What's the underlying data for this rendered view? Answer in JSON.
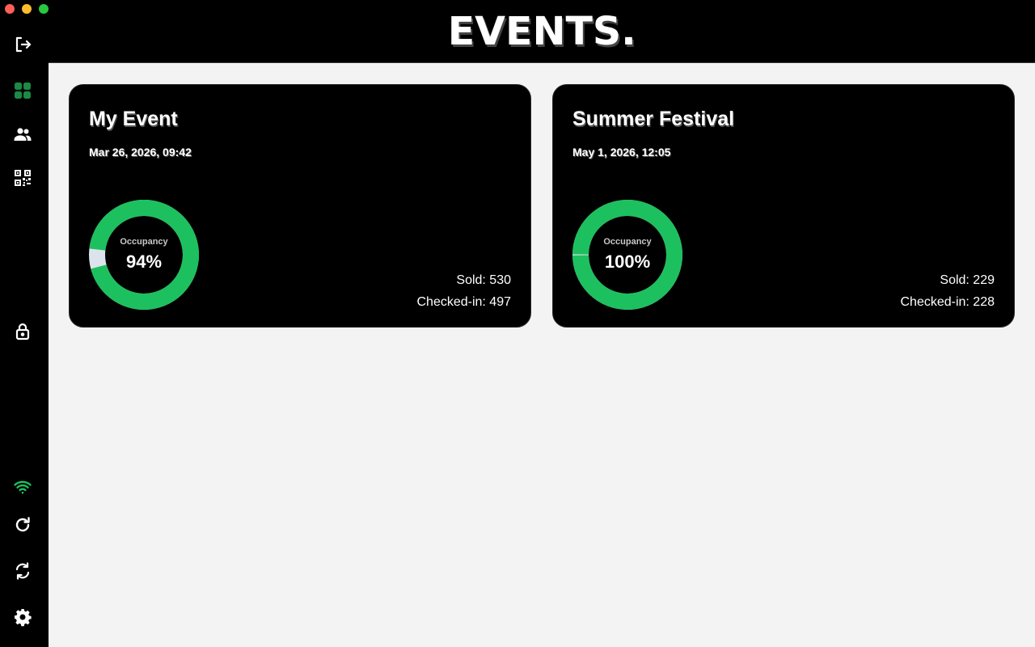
{
  "header": {
    "title": "EVENTS."
  },
  "sidebar": {
    "icons": [
      "logout-icon",
      "dashboard-icon",
      "users-icon",
      "qr-code-icon",
      "lock-icon",
      "wifi-icon",
      "refresh-icon",
      "sync-icon",
      "settings-icon"
    ]
  },
  "colors": {
    "accent": "#1dc05e",
    "ring_rest": "#dde3ec",
    "card_bg": "#000000",
    "page_bg": "#f3f3f3"
  },
  "events": [
    {
      "name": "My Event",
      "date": "Mar 26, 2026, 09:42",
      "occupancy_label": "Occupancy",
      "occupancy_text": "94%",
      "occupancy_fraction": 0.94,
      "sold": "Sold: 530",
      "checked_in": "Checked-in: 497"
    },
    {
      "name": "Summer Festival",
      "date": "May 1, 2026, 12:05",
      "occupancy_label": "Occupancy",
      "occupancy_text": "100%",
      "occupancy_fraction": 0.996,
      "sold": "Sold: 229",
      "checked_in": "Checked-in: 228"
    }
  ]
}
